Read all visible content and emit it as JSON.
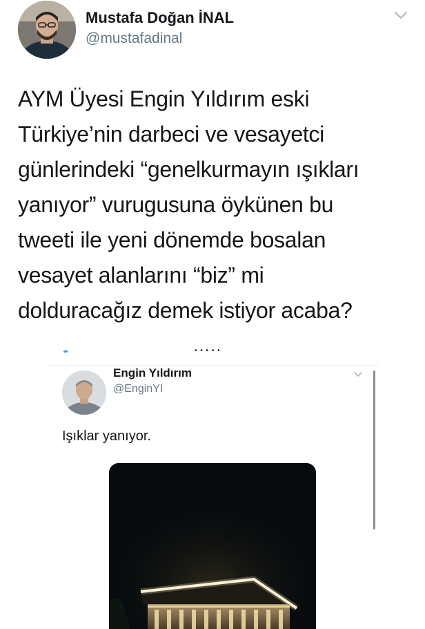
{
  "tweet": {
    "display_name": "Mustafa Doğan İNAL",
    "handle": "@mustafadinal",
    "text": "AYM Üyesi Engin Yıldırım eski\nTürkiye’nin darbeci ve vesayetci\ngünlerindeki “genelkurmayın ışıkları\nyanıyor” vurugusuna öykünen bu\ntweeti ile yeni dönemde bosalan\nvesayet alanlarını “biz” mi\ndolduracağız demek istiyor acaba?",
    "menu_icon": "chevron-down-icon",
    "avatar_icon": "user-avatar"
  },
  "quoted_screenshot": {
    "display_name": "Engin Yıldırım",
    "handle": "@EnginYI",
    "text": "Işıklar yanıyor.",
    "menu_icon": "chevron-down-icon",
    "avatar_icon": "user-avatar",
    "photo_icon": "night-building-photo",
    "top_fragment": "• • • • •"
  },
  "colors": {
    "text": "#14171a",
    "secondary_text": "#657786",
    "divider": "#e6ecf0",
    "accent": "#1da1f2",
    "photo_background": "#060a0d",
    "building_lights": "#f4e3b2"
  }
}
